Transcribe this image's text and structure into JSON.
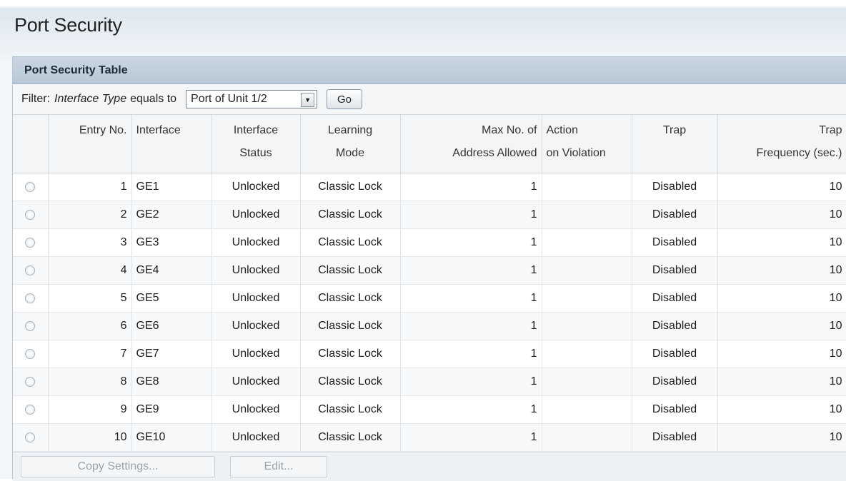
{
  "page": {
    "title": "Port Security"
  },
  "panel": {
    "title": "Port Security Table"
  },
  "filter": {
    "label": "Filter:",
    "field": "Interface Type",
    "operator": "equals to",
    "selected": "Port of Unit 1/2",
    "go_label": "Go"
  },
  "table": {
    "headers": [
      {
        "line1": "",
        "line2": ""
      },
      {
        "line1": "Entry No.",
        "line2": ""
      },
      {
        "line1": "Interface",
        "line2": ""
      },
      {
        "line1": "Interface",
        "line2": "Status"
      },
      {
        "line1": "Learning",
        "line2": "Mode"
      },
      {
        "line1": "Max No. of",
        "line2": "Address Allowed"
      },
      {
        "line1": "Action",
        "line2": "on Violation"
      },
      {
        "line1": "Trap",
        "line2": ""
      },
      {
        "line1": "Trap",
        "line2": "Frequency (sec.)"
      }
    ],
    "rows": [
      {
        "entry": "1",
        "interface": "GE1",
        "status": "Unlocked",
        "mode": "Classic Lock",
        "max": "1",
        "action": "",
        "trap": "Disabled",
        "freq": "10"
      },
      {
        "entry": "2",
        "interface": "GE2",
        "status": "Unlocked",
        "mode": "Classic Lock",
        "max": "1",
        "action": "",
        "trap": "Disabled",
        "freq": "10"
      },
      {
        "entry": "3",
        "interface": "GE3",
        "status": "Unlocked",
        "mode": "Classic Lock",
        "max": "1",
        "action": "",
        "trap": "Disabled",
        "freq": "10"
      },
      {
        "entry": "4",
        "interface": "GE4",
        "status": "Unlocked",
        "mode": "Classic Lock",
        "max": "1",
        "action": "",
        "trap": "Disabled",
        "freq": "10"
      },
      {
        "entry": "5",
        "interface": "GE5",
        "status": "Unlocked",
        "mode": "Classic Lock",
        "max": "1",
        "action": "",
        "trap": "Disabled",
        "freq": "10"
      },
      {
        "entry": "6",
        "interface": "GE6",
        "status": "Unlocked",
        "mode": "Classic Lock",
        "max": "1",
        "action": "",
        "trap": "Disabled",
        "freq": "10"
      },
      {
        "entry": "7",
        "interface": "GE7",
        "status": "Unlocked",
        "mode": "Classic Lock",
        "max": "1",
        "action": "",
        "trap": "Disabled",
        "freq": "10"
      },
      {
        "entry": "8",
        "interface": "GE8",
        "status": "Unlocked",
        "mode": "Classic Lock",
        "max": "1",
        "action": "",
        "trap": "Disabled",
        "freq": "10"
      },
      {
        "entry": "9",
        "interface": "GE9",
        "status": "Unlocked",
        "mode": "Classic Lock",
        "max": "1",
        "action": "",
        "trap": "Disabled",
        "freq": "10"
      },
      {
        "entry": "10",
        "interface": "GE10",
        "status": "Unlocked",
        "mode": "Classic Lock",
        "max": "1",
        "action": "",
        "trap": "Disabled",
        "freq": "10"
      }
    ]
  },
  "actions": {
    "copy_label": "Copy Settings...",
    "edit_label": "Edit..."
  },
  "icons": {
    "row_select": "radio-icon",
    "dropdown": "chevron-down-icon"
  }
}
